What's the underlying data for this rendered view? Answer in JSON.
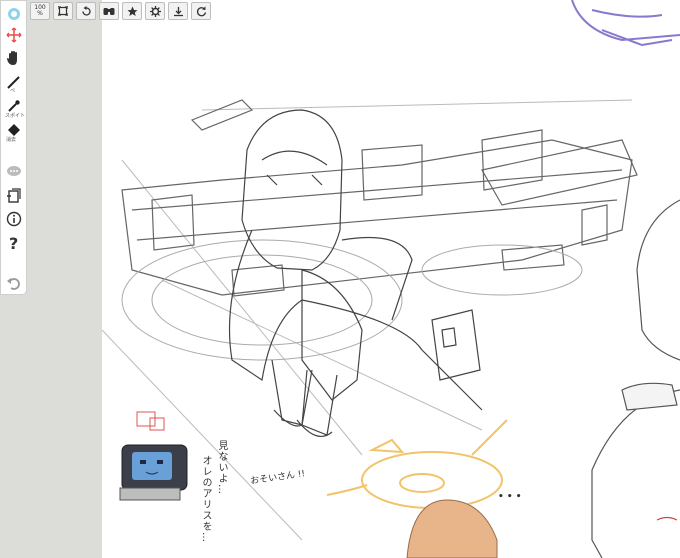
{
  "toolbar": {
    "zoom": "100",
    "zoom_unit": "%",
    "buttons": [
      "fit-screen-icon",
      "rotate-icon",
      "binoculars-icon",
      "star-icon",
      "settings-icon",
      "download-icon",
      "redo-icon"
    ]
  },
  "tools": [
    {
      "name": "color-wheel-icon"
    },
    {
      "name": "move-icon"
    },
    {
      "name": "hand-icon"
    },
    {
      "name": "pen-icon",
      "sub": "ペ"
    },
    {
      "name": "eyedropper-icon",
      "sub": "スポイト"
    },
    {
      "name": "fill-icon",
      "sub": "消去"
    },
    {
      "name": "chat-icon"
    },
    {
      "name": "layers-icon"
    },
    {
      "name": "info-icon"
    },
    {
      "name": "help-icon"
    },
    {
      "name": "undo-icon"
    }
  ],
  "canvas": {
    "text_vertical_1": "見ないよ…",
    "text_vertical_2": "オレのアリスを…",
    "text_note": "おそいさん !!",
    "text_dots": "• • •"
  },
  "colors": {
    "accent_halo": "#f2c46a",
    "sketch_line": "#555555",
    "hair_color": "#e8b58a",
    "purple_corner": "#8a78d0"
  }
}
